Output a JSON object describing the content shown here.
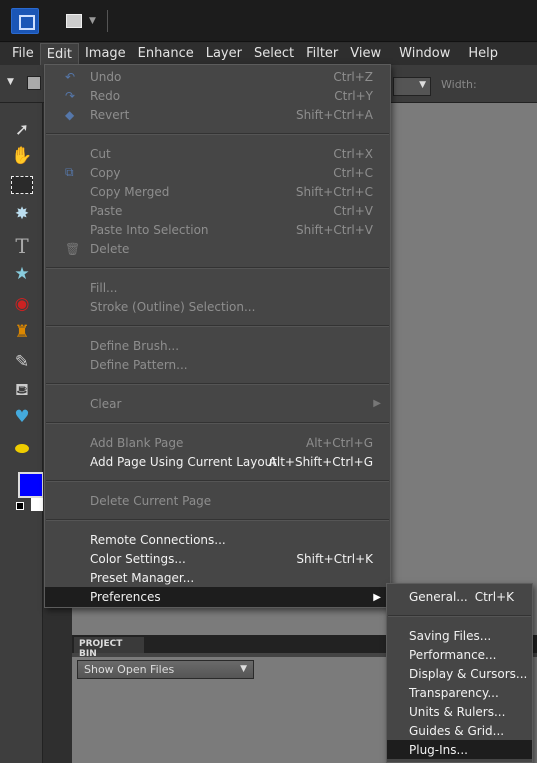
{
  "menubar": [
    "File",
    "Edit",
    "Image",
    "Enhance",
    "Layer",
    "Select",
    "Filter",
    "View",
    "Window",
    "Help"
  ],
  "options": {
    "width_label": "Width:"
  },
  "edit_menu": {
    "undo": {
      "label": "Undo",
      "shortcut": "Ctrl+Z"
    },
    "redo": {
      "label": "Redo",
      "shortcut": "Ctrl+Y"
    },
    "revert": {
      "label": "Revert",
      "shortcut": "Shift+Ctrl+A"
    },
    "cut": {
      "label": "Cut",
      "shortcut": "Ctrl+X"
    },
    "copy": {
      "label": "Copy",
      "shortcut": "Ctrl+C"
    },
    "copy_merged": {
      "label": "Copy Merged",
      "shortcut": "Shift+Ctrl+C"
    },
    "paste": {
      "label": "Paste",
      "shortcut": "Ctrl+V"
    },
    "paste_into": {
      "label": "Paste Into Selection",
      "shortcut": "Shift+Ctrl+V"
    },
    "delete": {
      "label": "Delete"
    },
    "fill": {
      "label": "Fill..."
    },
    "stroke": {
      "label": "Stroke (Outline) Selection..."
    },
    "define_brush": {
      "label": "Define Brush..."
    },
    "define_pattern": {
      "label": "Define Pattern..."
    },
    "clear": {
      "label": "Clear"
    },
    "add_blank": {
      "label": "Add Blank Page",
      "shortcut": "Alt+Ctrl+G"
    },
    "add_layout": {
      "label": "Add Page Using Current Layout",
      "shortcut": "Alt+Shift+Ctrl+G"
    },
    "delete_page": {
      "label": "Delete Current Page"
    },
    "remote": {
      "label": "Remote Connections..."
    },
    "color": {
      "label": "Color Settings...",
      "shortcut": "Shift+Ctrl+K"
    },
    "preset": {
      "label": "Preset Manager..."
    },
    "preferences": {
      "label": "Preferences"
    }
  },
  "preferences_submenu": {
    "general": {
      "label": "General...",
      "shortcut": "Ctrl+K"
    },
    "items": [
      "Saving Files...",
      "Performance...",
      "Display & Cursors...",
      "Transparency...",
      "Units & Rulers...",
      "Guides & Grid...",
      "Plug-Ins..."
    ]
  },
  "project_bin": {
    "title": "PROJECT BIN",
    "select_value": "Show Open Files"
  },
  "colors": {
    "foreground": "#0000ff",
    "background": "#ffffff",
    "highlight": "#1d1d1d"
  }
}
